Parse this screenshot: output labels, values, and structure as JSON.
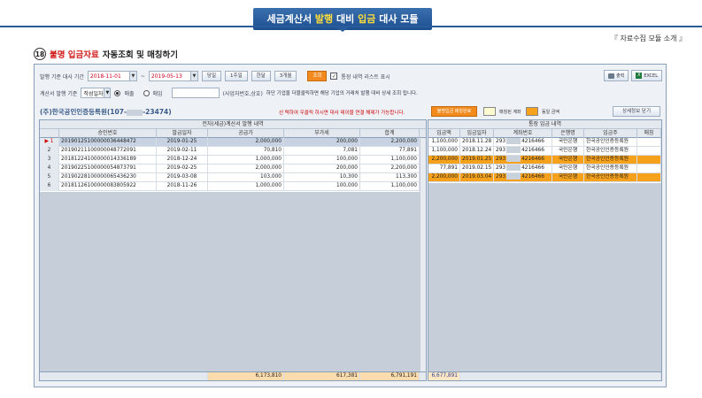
{
  "banner": {
    "part1": "세금계산서",
    "part2": "발행",
    "part3": "대비",
    "part4": "입금",
    "part5": "대사 모듈"
  },
  "top_right": "『 자료수집 모듈 소개 』",
  "section": {
    "num": "18",
    "red": "불명 입금자료",
    "rest": "자동조회 및 매칭하기"
  },
  "toolbar": {
    "period_label": "발행 기준 대사 기간",
    "date_from": "2018-11-01",
    "tilde": "~",
    "date_to": "2019-05-13",
    "quick": [
      "당일",
      "1주일",
      "한달",
      "3개월"
    ],
    "search": "조회",
    "show_bank_list": "통장 내역 리스트 표시",
    "print": "출력",
    "excel": "EXCEL"
  },
  "filter": {
    "label": "계산서 발행 기준",
    "select": "작성일자",
    "radio_sale": "매출",
    "radio_buy": "매입",
    "bizno_hint": "(사업자번호,상호)",
    "desc": "하단 기업을 더블클릭하면 해당 기업의 거래처 발행 대비 상세 조회 됩니다."
  },
  "company": {
    "prefix": "(주)한국공인인증등록원(107-",
    "suffix": "-23474)"
  },
  "notice": "선 택하여 우클릭 하시면 대사 테이블 연결 해제가 가능합니다.",
  "legend": {
    "btn": "불명입금 매칭완료",
    "matched_total": "매칭된 계좌",
    "same_amount": "동일 금액"
  },
  "detail_btn": "상세정보 닫기",
  "left_grid": {
    "title": "전자(세금)계산서 발행 내역",
    "columns": [
      "승인번호",
      "발급일자",
      "공급가",
      "부가세",
      "합계"
    ],
    "rows": [
      [
        "20190125100000036448472",
        "2019-01-25",
        "2,000,000",
        "200,000",
        "2,200,000"
      ],
      [
        "20190211100000048772091",
        "2019-02-11",
        "70,810",
        "7,081",
        "77,891"
      ],
      [
        "20181224100000014336189",
        "2018-12-24",
        "1,000,000",
        "100,000",
        "1,100,000"
      ],
      [
        "20190225100000054873791",
        "2019-02-25",
        "2,000,000",
        "200,000",
        "2,200,000"
      ],
      [
        "20190228100000065436230",
        "2019-03-08",
        "103,000",
        "10,300",
        "113,300"
      ],
      [
        "20181126100000083805922",
        "2018-11-26",
        "1,000,000",
        "100,000",
        "1,100,000"
      ]
    ],
    "totals": [
      "6,173,810",
      "617,381",
      "6,791,191"
    ]
  },
  "right_grid": {
    "title": "통장 입금 내역",
    "columns": [
      "입금액",
      "입금일자",
      "계좌번호",
      "은행명",
      "입금주",
      "매칭"
    ],
    "rows": [
      {
        "amount": "1,100,000",
        "date": "2018.11.28",
        "acct_a": "293",
        "acct_b": "4216466",
        "bank": "국민은행",
        "depositor": "한국공인인증등록원",
        "match": "",
        "hl": false
      },
      {
        "amount": "1,100,000",
        "date": "2018.12.24",
        "acct_a": "293",
        "acct_b": "4216466",
        "bank": "국민은행",
        "depositor": "한국공인인증등록원",
        "match": "",
        "hl": false
      },
      {
        "amount": "2,200,000",
        "date": "2019.01.25",
        "acct_a": "293",
        "acct_b": "4216466",
        "bank": "국민은행",
        "depositor": "한국공인인증등록원",
        "match": "",
        "hl": true
      },
      {
        "amount": "77,891",
        "date": "2019.02.15",
        "acct_a": "293",
        "acct_b": "4216466",
        "bank": "국민은행",
        "depositor": "한국공인인증등록원",
        "match": "",
        "hl": false
      },
      {
        "amount": "2,200,000",
        "date": "2019.03.04",
        "acct_a": "293",
        "acct_b": "4216466",
        "bank": "국민은행",
        "depositor": "한국공인인증등록원",
        "match": "",
        "hl": true
      }
    ],
    "total": "6,677,891"
  },
  "colors": {
    "accent": "#1d4f8f",
    "orange": "#f6a11b",
    "search_btn": "#f28a1d",
    "selected_row": "#c7d3e2"
  }
}
